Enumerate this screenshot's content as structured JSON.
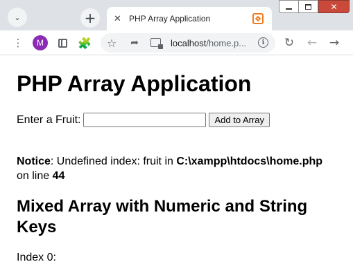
{
  "browser": {
    "tab_title": "PHP Array Application",
    "profile_initial": "M",
    "url_host": "localhost",
    "url_path": "/home.p..."
  },
  "page": {
    "heading": "PHP Array Application",
    "form": {
      "label": "Enter a Fruit:",
      "input_value": "",
      "button_label": "Add to Array"
    },
    "notice": {
      "label": "Notice",
      "text1": ": Undefined index: fruit in ",
      "path": "C:\\xampp\\htdocs\\home.php",
      "text2": " on line ",
      "line": "44"
    },
    "subheading": "Mixed Array with Numeric and String Keys",
    "index_line": "Index 0:"
  },
  "colors": {
    "profile_avatar": "#8b2bb5",
    "favicon": "#f37b1d",
    "window_close": "#c94a3a"
  },
  "icons": [
    "tab-search-icon",
    "new-tab-icon",
    "close-tab-icon",
    "favicon-icon",
    "menu-icon",
    "side-panel-icon",
    "extensions-icon",
    "bookmark-star-icon",
    "share-icon",
    "site-info-icon",
    "info-icon",
    "reload-icon",
    "back-icon",
    "forward-icon"
  ]
}
